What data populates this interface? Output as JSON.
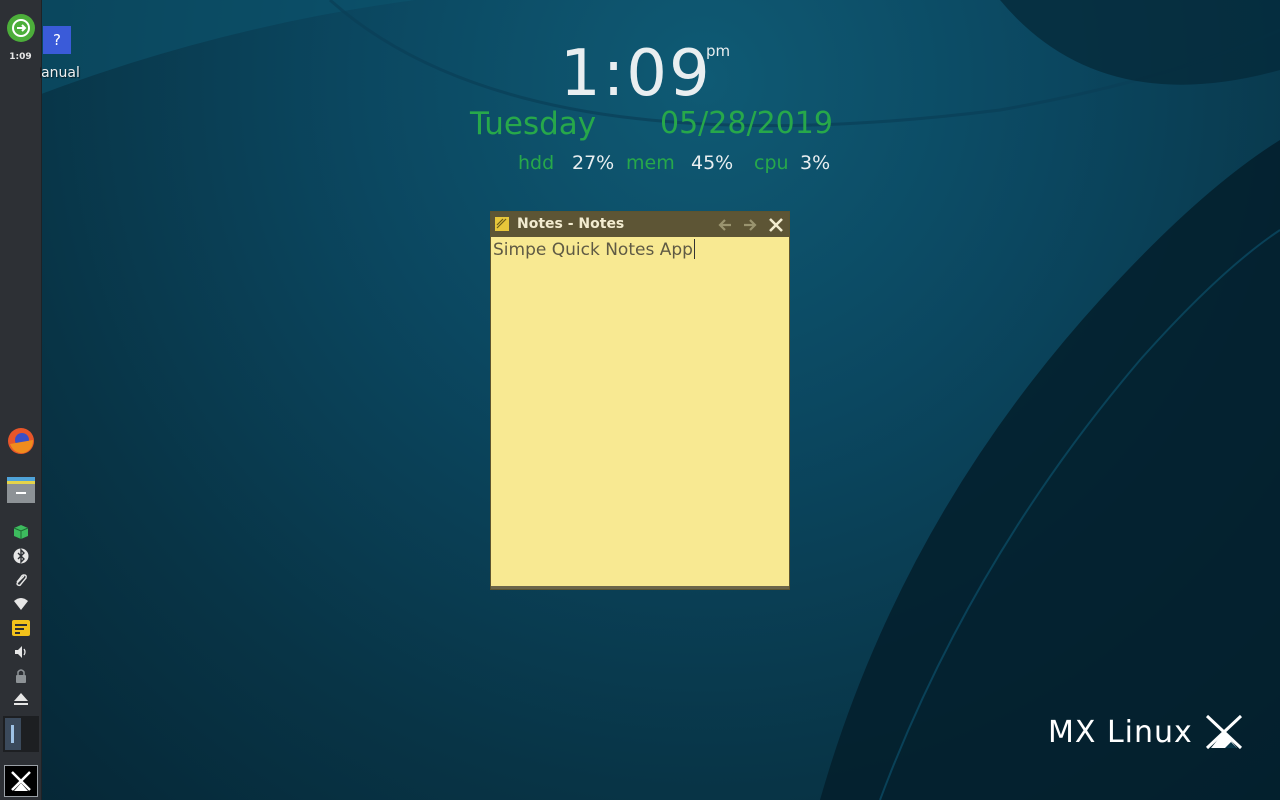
{
  "desktop": {
    "icons": [
      {
        "label": "Manual",
        "glyph": "?"
      }
    ]
  },
  "panel": {
    "clock": "1:09",
    "items": [
      {
        "name": "logout-icon"
      },
      {
        "name": "firefox-icon"
      },
      {
        "name": "file-manager-icon"
      },
      {
        "name": "package-icon"
      },
      {
        "name": "bluetooth-icon"
      },
      {
        "name": "clipboard-icon"
      },
      {
        "name": "network-icon"
      },
      {
        "name": "notes-tray-icon"
      },
      {
        "name": "volume-icon"
      },
      {
        "name": "lock-icon"
      },
      {
        "name": "eject-icon"
      },
      {
        "name": "workspace-pager"
      },
      {
        "name": "mx-menu-icon"
      }
    ]
  },
  "conky": {
    "time": "1:09",
    "ampm": "pm",
    "day": "Tuesday",
    "date": "05/28/2019",
    "stats": [
      {
        "label": "hdd",
        "value": "27%"
      },
      {
        "label": "mem",
        "value": "45%"
      },
      {
        "label": "cpu",
        "value": "3%"
      }
    ],
    "accent_color": "#27a84a"
  },
  "notes_window": {
    "title": "Notes - Notes",
    "content": "Simpe Quick Notes App",
    "background": "#f8e992",
    "titlebar_color": "#5d5535"
  },
  "logo": {
    "text": "MX Linux"
  }
}
